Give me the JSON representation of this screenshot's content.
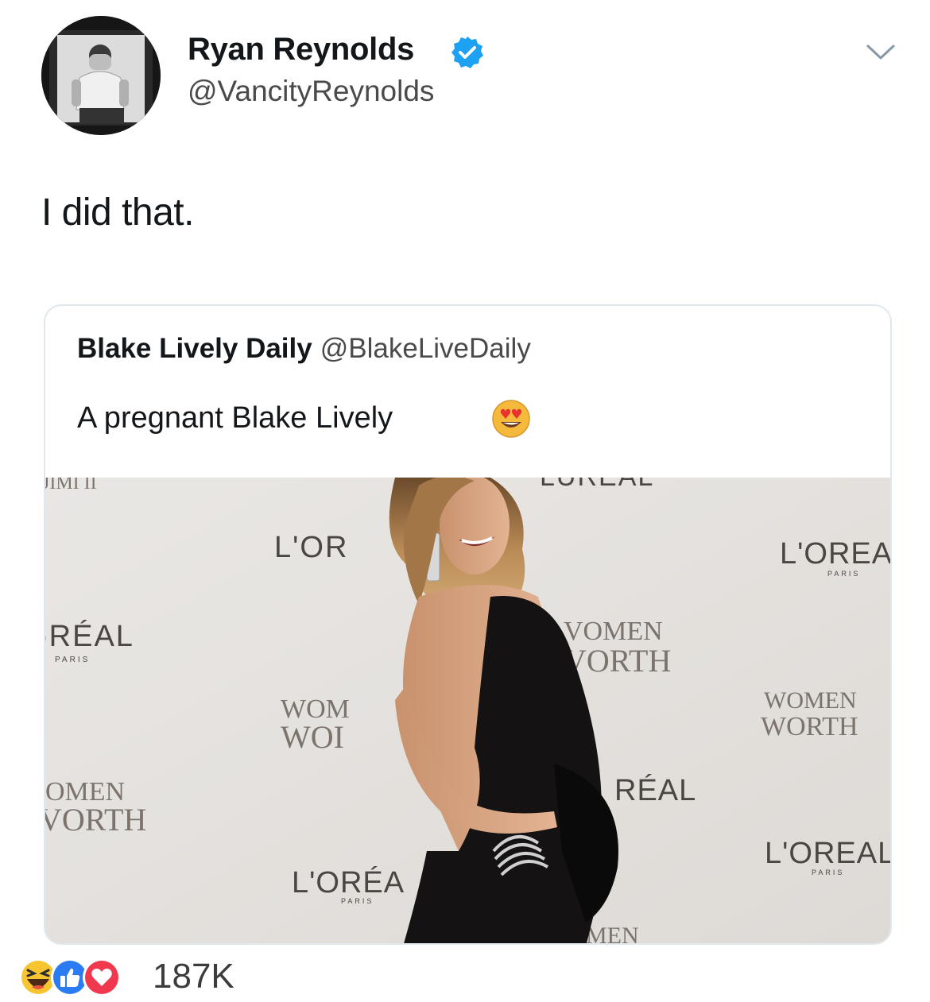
{
  "author": {
    "display_name": "Ryan Reynolds",
    "handle": "@VancityReynolds",
    "verified": true,
    "verified_color": "#1da1f2"
  },
  "tweet": {
    "text": "I did that."
  },
  "quoted_tweet": {
    "display_name": "Blake Lively Daily",
    "handle": "@BlakeLiveDaily",
    "text": "A pregnant Blake Lively",
    "emoji": "heart-eyes-icon",
    "photo": {
      "backdrop_text": [
        "L'OREAL",
        "PARIS",
        "WOMEN of WORTH"
      ]
    }
  },
  "reactions": {
    "icons": [
      "haha-icon",
      "like-icon",
      "love-icon"
    ],
    "count": "187K",
    "colors": {
      "like": "#2b7bf3",
      "love": "#f0384f",
      "haha": "#f7c531"
    }
  }
}
